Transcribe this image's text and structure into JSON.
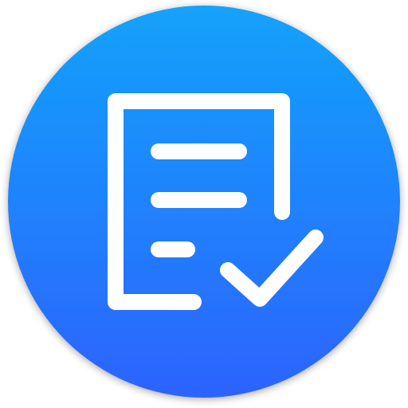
{
  "icon": {
    "name": "document-check-icon",
    "colors": {
      "gradient_top": "#12a2fb",
      "gradient_bottom": "#2d63fd",
      "glyph": "#ffffff"
    }
  }
}
